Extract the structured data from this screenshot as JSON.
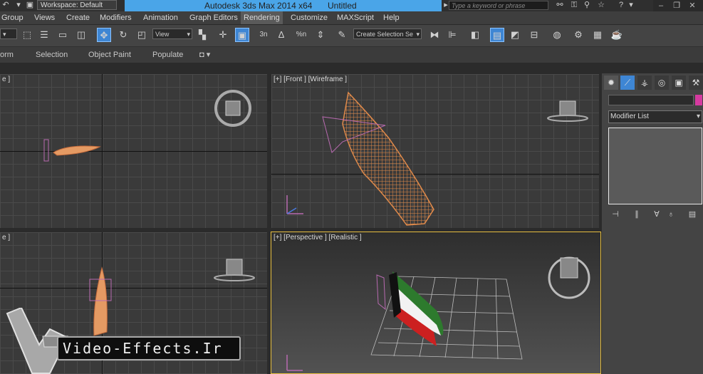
{
  "titlebar": {
    "workspace": "Workspace: Default",
    "app_title": "Autodesk 3ds Max  2014 x64",
    "doc_title": "Untitled",
    "search_placeholder": "Type a keyword or phrase"
  },
  "menu": {
    "items": [
      "Group",
      "Views",
      "Create",
      "Modifiers",
      "Animation",
      "Graph Editors",
      "Rendering",
      "Customize",
      "MAXScript",
      "Help"
    ],
    "active": "Rendering"
  },
  "toolbar": {
    "view_combo": "View",
    "selection_set_placeholder": "Create Selection Se",
    "snap_labels": [
      "3n",
      "%n"
    ]
  },
  "ribbon": {
    "tabs": [
      "orm",
      "Selection",
      "Object Paint",
      "Populate"
    ]
  },
  "viewports": {
    "top_left_label": "e ]",
    "front_label": "[+] [Front ] [Wireframe ]",
    "left_label": "e ]",
    "perspective_label": "[+] [Perspective ] [Realistic ]"
  },
  "command_panel": {
    "modifier_list": "Modifier List",
    "accent_color": "#d63aa0"
  },
  "watermark": {
    "text": "Video-Effects.Ir"
  },
  "colors": {
    "title_blue": "#4aa5e8",
    "selected_tool": "#3e86d4",
    "active_viewport_border": "#e8c040",
    "wire_orange": "#e08a4a"
  }
}
